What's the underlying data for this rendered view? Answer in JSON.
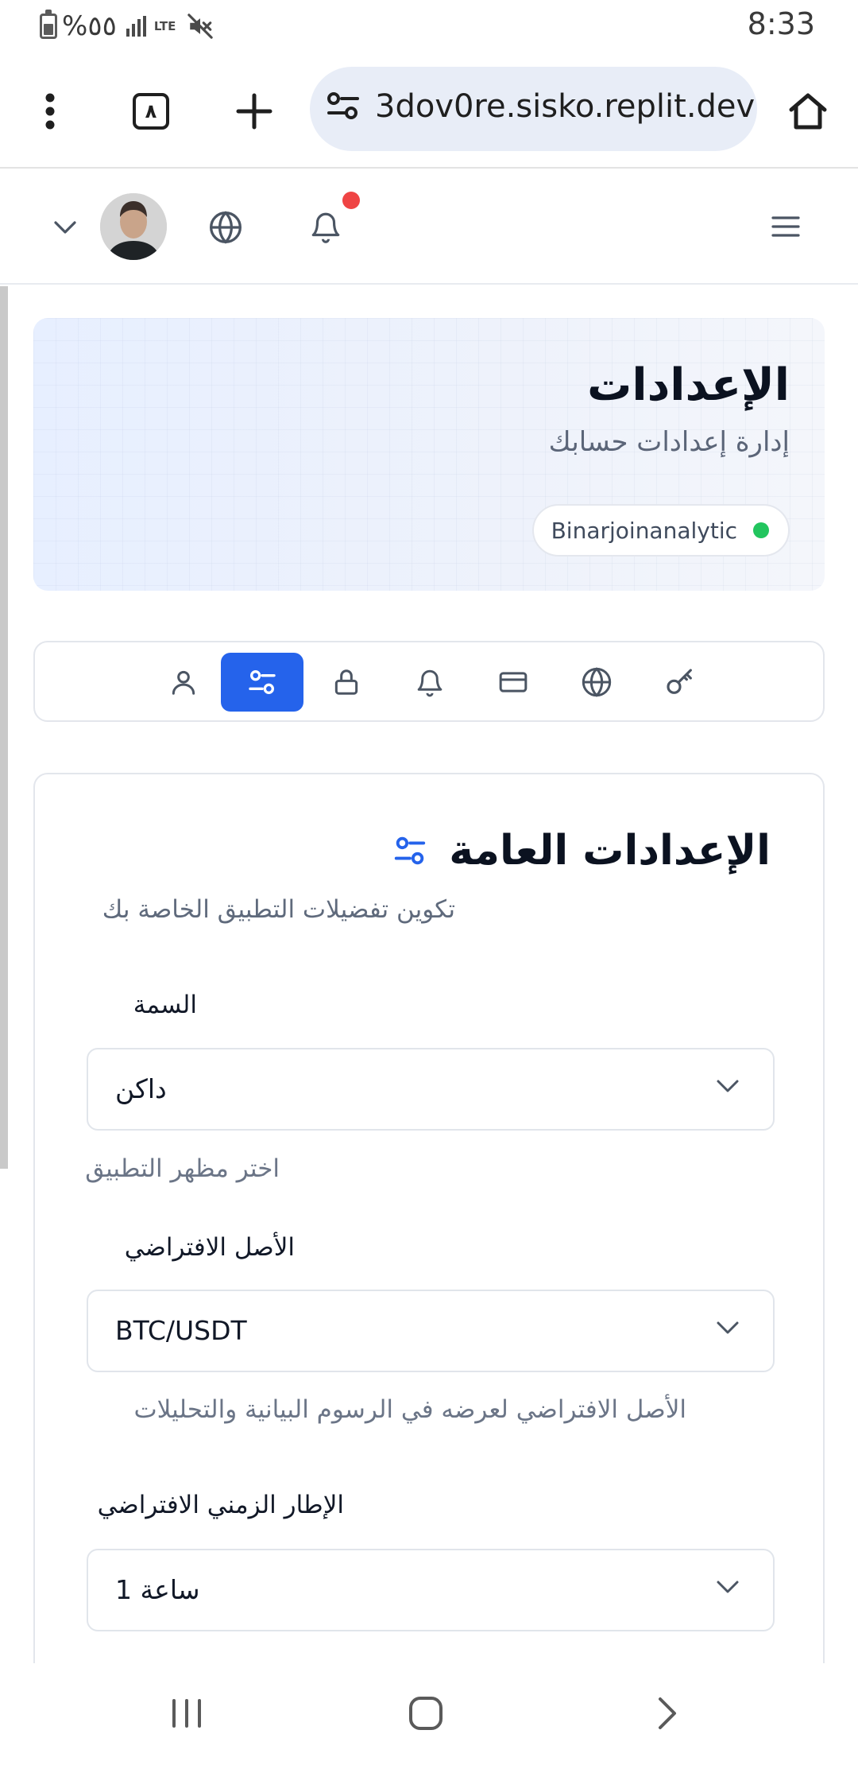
{
  "status_bar": {
    "battery_percent": "%٥٥",
    "network_label": "LTE",
    "time": "8:33"
  },
  "browser": {
    "tab_count": "٨",
    "url": "3dov0re.sisko.replit.dev"
  },
  "header": {
    "notification_dot_color": "#ef4444"
  },
  "hero": {
    "title": "الإعدادات",
    "subtitle": "إدارة إعدادات حسابك",
    "brand": "Binarjoinanalytic",
    "status_color": "#22c55e"
  },
  "tabs": [
    {
      "icon": "user-icon",
      "active": false
    },
    {
      "icon": "sliders-icon",
      "active": true
    },
    {
      "icon": "lock-icon",
      "active": false
    },
    {
      "icon": "bell-icon",
      "active": false
    },
    {
      "icon": "credit-card-icon",
      "active": false
    },
    {
      "icon": "globe-icon",
      "active": false
    },
    {
      "icon": "key-icon",
      "active": false
    }
  ],
  "general": {
    "title": "الإعدادات العامة",
    "subtitle": "تكوين تفضيلات التطبيق الخاصة بك",
    "theme": {
      "label": "السمة",
      "value": "داكن",
      "help": "اختر مظهر التطبيق"
    },
    "asset": {
      "label": "الأصل الافتراضي",
      "value": "BTC/USDT",
      "help": "الأصل الافتراضي لعرضه في الرسوم البيانية والتحليلات"
    },
    "timeframe": {
      "label": "الإطار الزمني الافتراضي",
      "value": "ساعة 1"
    }
  },
  "accent_color": "#2563eb"
}
